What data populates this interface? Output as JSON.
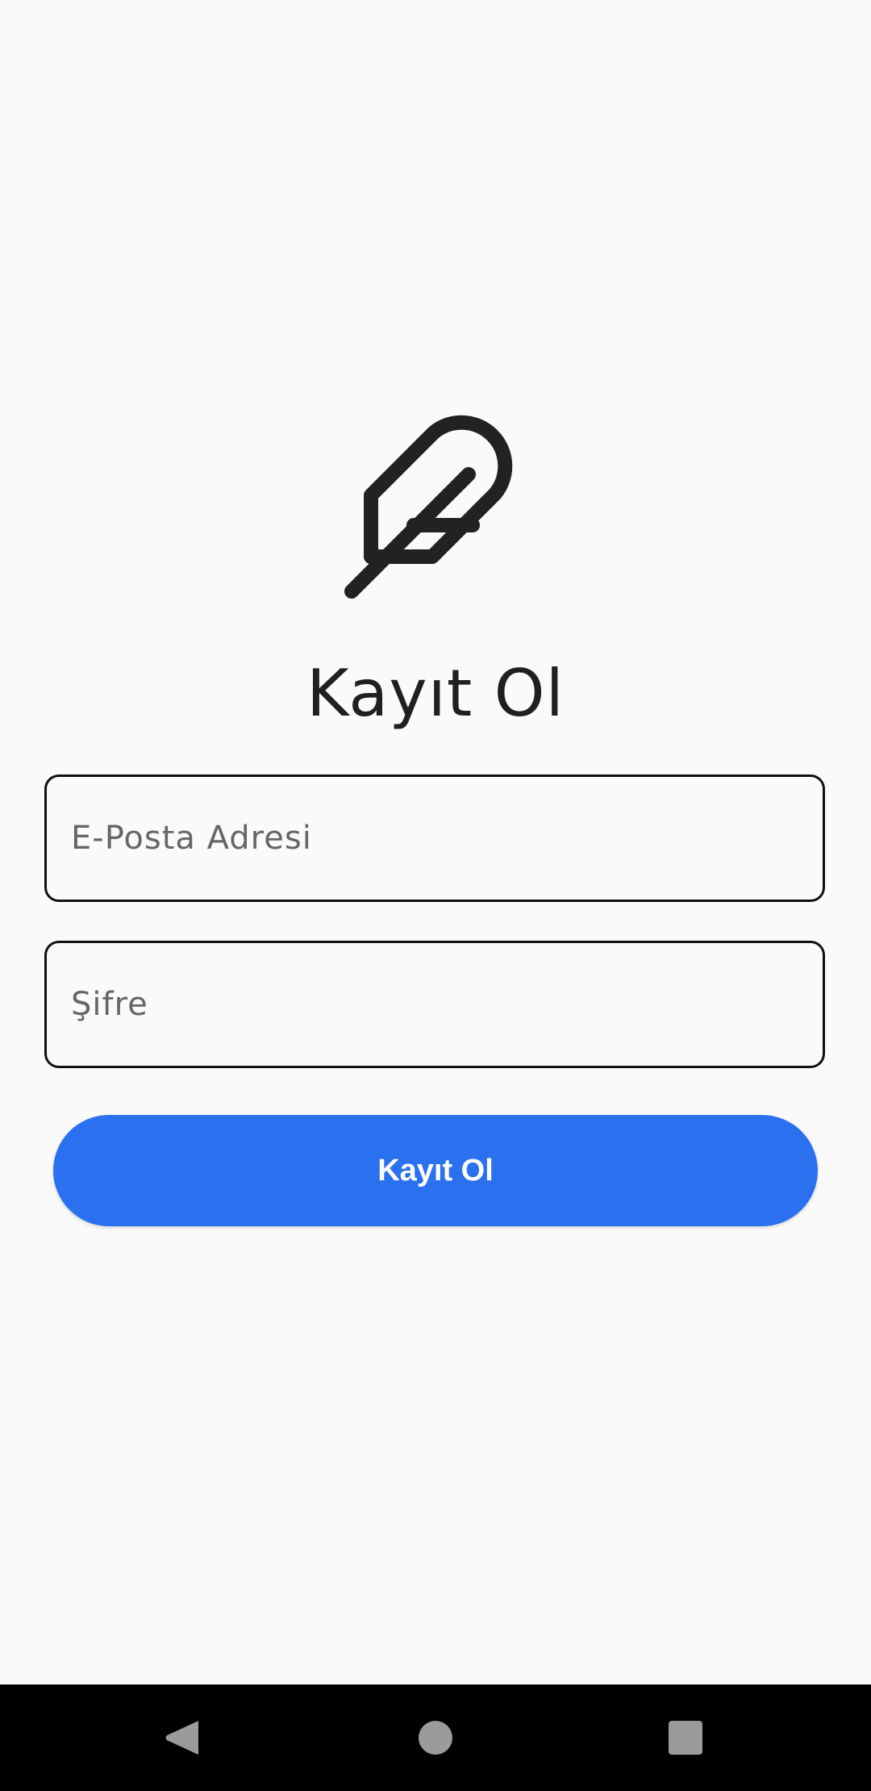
{
  "app": {
    "logo_icon": "feather-icon",
    "title": "Kayıt Ol"
  },
  "form": {
    "email_placeholder": "E-Posta Adresi",
    "password_placeholder": "Şifre",
    "submit_label": "Kayıt Ol"
  },
  "nav": {
    "back_icon": "back-triangle-icon",
    "home_icon": "home-circle-icon",
    "recents_icon": "recents-square-icon"
  },
  "colors": {
    "background": "#fafafa",
    "primary": "#2a70ef",
    "text": "#202020",
    "nav_background": "#000000"
  }
}
